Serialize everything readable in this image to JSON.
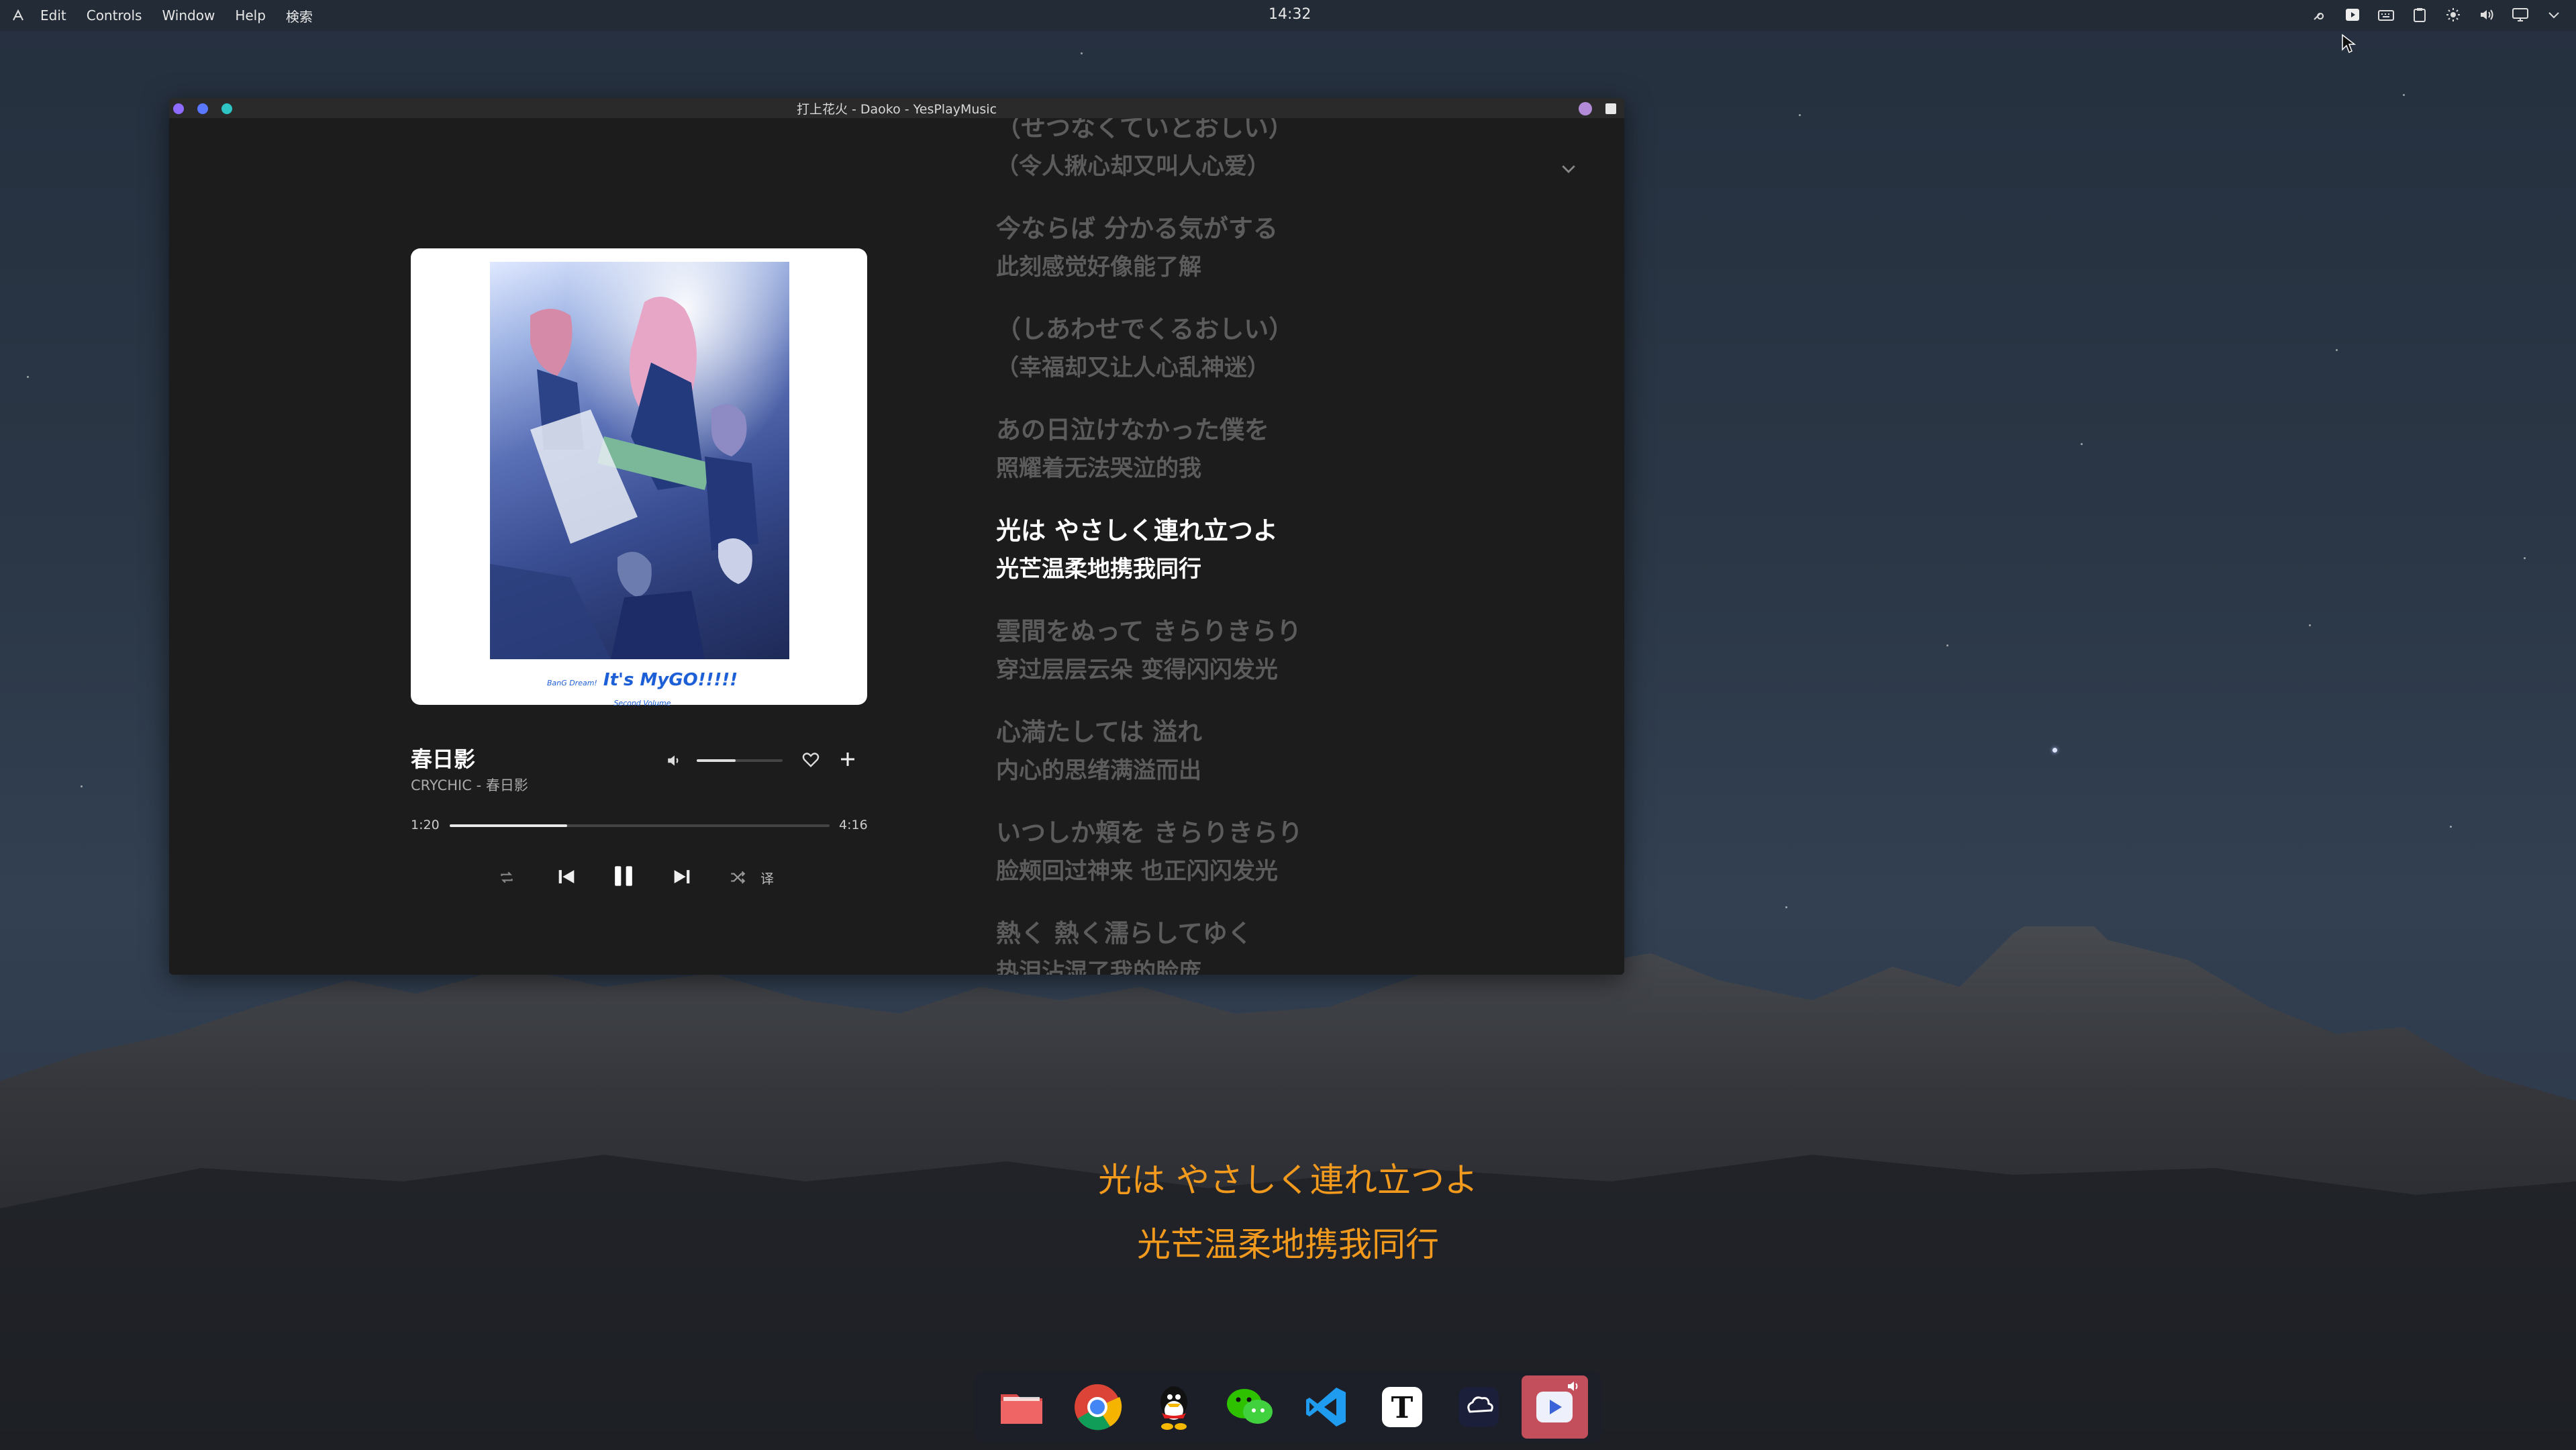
{
  "menubar": {
    "items": [
      "Edit",
      "Controls",
      "Window",
      "Help",
      "検索"
    ],
    "clock": "14:32",
    "tray_icons": [
      "key-icon",
      "play-icon",
      "keyboard-icon",
      "clipboard-icon",
      "brightness-icon",
      "volume-icon",
      "display-icon",
      "chevron-down-icon"
    ]
  },
  "window": {
    "title": "打上花火 - Daoko - YesPlayMusic"
  },
  "player": {
    "album_logo": "It's MyGO!!!!!",
    "album_logo_small_left": "BanG Dream!",
    "album_logo_small_right": "Second Volume",
    "song_title": "春日影",
    "artist_line": "CRYCHIC - 春日影",
    "volume_level": 0.45,
    "progress_fraction": 0.31,
    "time_current": "1:20",
    "time_total": "4:16",
    "translate_label": "译"
  },
  "lyrics": [
    {
      "jp": "（せつなくていとおしい）",
      "cn": "（令人揪心却又叫人心爱）",
      "active": false
    },
    {
      "jp": "今ならば 分かる気がする",
      "cn": "此刻感觉好像能了解",
      "active": false
    },
    {
      "jp": "（しあわせでくるおしい）",
      "cn": "（幸福却又让人心乱神迷）",
      "active": false
    },
    {
      "jp": "あの日泣けなかった僕を",
      "cn": "照耀着无法哭泣的我",
      "active": false
    },
    {
      "jp": "光は やさしく連れ立つよ",
      "cn": "光芒温柔地携我同行",
      "active": true
    },
    {
      "jp": "雲間をぬって きらりきらり",
      "cn": "穿过层层云朵 变得闪闪发光",
      "active": false
    },
    {
      "jp": "心満たしては 溢れ",
      "cn": "内心的思绪满溢而出",
      "active": false
    },
    {
      "jp": "いつしか頬を きらりきらり",
      "cn": "脸颊回过神来 也正闪闪发光",
      "active": false
    },
    {
      "jp": "熱く 熱く濡らしてゆく",
      "cn": "热泪沾湿了我的脸庞",
      "active": false
    }
  ],
  "desktop_lyrics": {
    "line1": "光は やさしく連れ立つよ",
    "line2": "光芒温柔地携我同行",
    "color": "#f29a1e"
  },
  "dock": {
    "apps": [
      "files",
      "chrome",
      "qq",
      "wechat",
      "vscode",
      "typora",
      "cloud-app",
      "yesplaymusic"
    ]
  }
}
